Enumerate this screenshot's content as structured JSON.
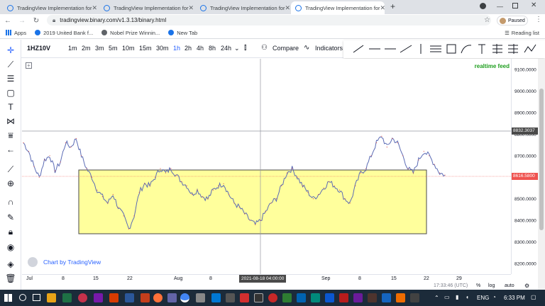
{
  "browser": {
    "tabs": [
      {
        "title": "TradingView Implementation for",
        "active": false
      },
      {
        "title": "TradingView Implementation for",
        "active": false
      },
      {
        "title": "TradingView Implementation for",
        "active": false
      },
      {
        "title": "TradingView Implementation for",
        "active": true
      }
    ],
    "new_tab_label": "+",
    "url": "tradingview.binary.com/v1.3.13/binary.html",
    "profile_label": "Paused",
    "bookmarks": [
      "Apps",
      "2019 United Bank f...",
      "Nobel Prize Winnin...",
      "New Tab"
    ],
    "reading_list": "Reading list"
  },
  "toolbar": {
    "symbol": "1HZ10V",
    "intervals": [
      "1m",
      "2m",
      "3m",
      "5m",
      "10m",
      "15m",
      "30m",
      "1h",
      "2h",
      "4h",
      "8h",
      "24h"
    ],
    "active_interval": "1h",
    "compare_label": "Compare",
    "indicators_label": "Indicators"
  },
  "chart": {
    "realtime_label": "realtime feed",
    "attribution": "Chart by TradingView",
    "price_ticks": [
      "9100.0000",
      "9000.0000",
      "8900.0000",
      "8800.0000",
      "8700.0000",
      "8600.0000",
      "8500.0000",
      "8400.0000",
      "8300.0000",
      "8200.0000"
    ],
    "crosshair_price": "8832.3037",
    "last_price": "8616.5800",
    "time_ticks": [
      "Jul",
      "8",
      "15",
      "22",
      "Aug",
      "8",
      "Sep",
      "8",
      "15",
      "22",
      "29"
    ],
    "crosshair_time": "2021-08-18 04:00:00",
    "accent_color": "#2962ff",
    "rect_fill": "#ffff9c",
    "rect_stroke": "#4a4a4a"
  },
  "chart_data": {
    "type": "line",
    "title": "",
    "ylim": [
      8150,
      9150
    ],
    "series": [
      {
        "values": [
          8760,
          8720,
          8650,
          8600,
          8680,
          8700,
          8630,
          8670,
          8760,
          8740,
          8780,
          8700,
          8640,
          8600,
          8540,
          8510,
          8480,
          8520,
          8460,
          8420,
          8360,
          8420,
          8530,
          8570,
          8560,
          8600,
          8640,
          8620,
          8640,
          8610,
          8580,
          8560,
          8520,
          8540,
          8510,
          8500,
          8540,
          8560,
          8570,
          8520,
          8480,
          8460,
          8430,
          8400,
          8380,
          8400,
          8440,
          8480,
          8500,
          8560,
          8620,
          8640,
          8600,
          8560,
          8530,
          8500,
          8520,
          8550,
          8580,
          8560,
          8540,
          8500,
          8480,
          8560,
          8620,
          8640,
          8700,
          8760,
          8790,
          8740,
          8780,
          8760,
          8700,
          8640,
          8620,
          8680,
          8720,
          8700,
          8660,
          8620,
          8610
        ]
      }
    ],
    "bottom_bar": {
      "time": "17:33:46 (UTC)",
      "pct": "%",
      "log": "log",
      "auto": "auto"
    }
  },
  "taskbar": {
    "time": "6:33 PM",
    "lang": "ENG"
  }
}
